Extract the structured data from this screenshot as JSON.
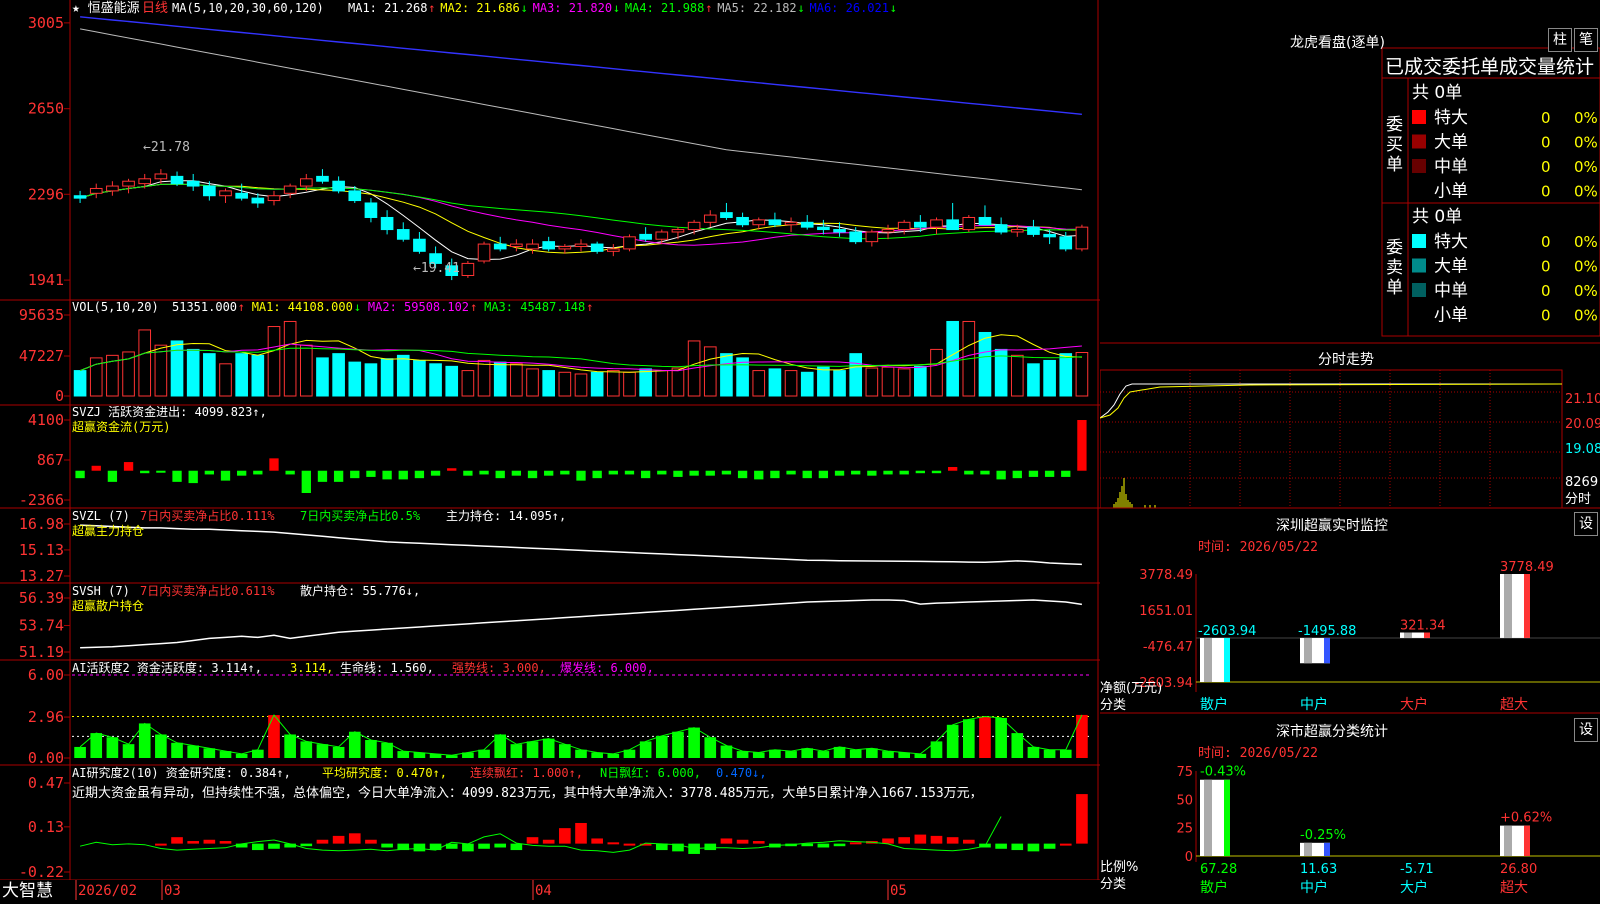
{
  "stock": {
    "name": "恒盛能源",
    "period": "日线",
    "star": "★",
    "ma_params": "MA(5,10,20,30,60,120)",
    "ma_values": [
      {
        "label": "MA1: 21.268",
        "arrow": "↑",
        "color": "#ffffff"
      },
      {
        "label": "MA2: 21.686",
        "arrow": "↓",
        "color": "#ffff00"
      },
      {
        "label": "MA3: 21.820",
        "arrow": "↓",
        "color": "#ff00ff"
      },
      {
        "label": "MA4: 21.988",
        "arrow": "↑",
        "color": "#00ff00"
      },
      {
        "label": "MA5: 22.182",
        "arrow": "↓",
        "color": "#bbbbbb"
      },
      {
        "label": "MA6: 26.021",
        "arrow": "↓",
        "color": "#0000ff"
      }
    ],
    "high_label": "←21.78",
    "low_label": "←19.41"
  },
  "panels": {
    "price": {
      "ticks": [
        "3005",
        "2650",
        "2296",
        "1941"
      ]
    },
    "vol": {
      "ticks": [
        "95635",
        "47227",
        "0"
      ],
      "title": "VOL(5,10,20)",
      "items": [
        {
          "text": "51351.000",
          "arrow": "↑",
          "color": "#ffffff"
        },
        {
          "text": "MA1: 44108.000",
          "arrow": "↓",
          "color": "#ffff00"
        },
        {
          "text": "MA2: 59508.102",
          "arrow": "↑",
          "color": "#ff00ff"
        },
        {
          "text": "MA3: 45487.148",
          "arrow": "↑",
          "color": "#00ff00"
        }
      ]
    },
    "svzj": {
      "ticks": [
        "4100",
        "867",
        "-2366"
      ],
      "title": "SVZJ  活跃资金进出: 4099.823↑,",
      "subtitle": "超赢资金流(万元)"
    },
    "svzl": {
      "ticks": [
        "16.98",
        "15.13",
        "13.27"
      ],
      "title_a": "SVZL (7)",
      "title_b": "7日内买卖净占比0.111%",
      "title_c": "7日内买卖净占比0.5%",
      "title_d": "主力持仓: 14.095↑,",
      "subtitle": "超赢主力持仓"
    },
    "svsh": {
      "ticks": [
        "56.39",
        "53.74",
        "51.19"
      ],
      "title_a": "SVSH (7)",
      "title_b": "7日内买卖净占比0.611%",
      "title_c": "散户持仓: 55.776↓,",
      "subtitle": "超赢散户持仓"
    },
    "ai1": {
      "ticks": [
        "6.00",
        "2.96",
        "0.00"
      ],
      "title_a": "AI活跃度2 资金活跃度: 3.114↑,",
      "title_b": "3.114,",
      "title_c": "生命线: 1.560,",
      "title_d": "强势线: 3.000,",
      "title_e": "爆发线: 6.000,"
    },
    "ai2": {
      "ticks": [
        "0.47",
        "0.13",
        "-0.22"
      ],
      "title_a": "AI研究度2(10) 资金研究度: 0.384↑,",
      "title_b": "平均研究度: 0.470↑,",
      "title_c": "连续飘红: 1.000↑,",
      "title_d": "N日飘红: 6.000,",
      "title_e": "0.470↓,",
      "comment": "近期大资金虽有异动，但持续性不强，总体偏空，今日大单净流入：4099.823万元，其中特大单净流入：3778.485万元，大单5日累计净入1667.153万元，"
    }
  },
  "footer": {
    "brand": "大智慧",
    "date_labels": [
      "2026/02",
      "03",
      "04",
      "05"
    ]
  },
  "longhu": {
    "title": "龙虎看盘(逐单)",
    "btn_zhu": "柱",
    "btn_bi": "笔",
    "header": "已成交委托单成交量统计",
    "buy_label": "委买单",
    "sell_label": "委卖单",
    "buy_total": "共 0单",
    "sell_total": "共 0单",
    "buy_rows": [
      {
        "name": "特大",
        "count": "0",
        "pct": "0%",
        "color": "#ff0000"
      },
      {
        "name": "大单",
        "count": "0",
        "pct": "0%",
        "color": "#990000"
      },
      {
        "name": "中单",
        "count": "0",
        "pct": "0%",
        "color": "#660000"
      },
      {
        "name": "小单",
        "count": "0",
        "pct": "0%",
        "color": "#000000"
      }
    ],
    "sell_rows": [
      {
        "name": "特大",
        "count": "0",
        "pct": "0%",
        "color": "#00ffff"
      },
      {
        "name": "大单",
        "count": "0",
        "pct": "0%",
        "color": "#008b8b"
      },
      {
        "name": "中单",
        "count": "0",
        "pct": "0%",
        "color": "#006060"
      },
      {
        "name": "小单",
        "count": "0",
        "pct": "0%",
        "color": "#000000"
      }
    ]
  },
  "fenshi": {
    "title": "分时走势",
    "ticks": [
      "21.10",
      "20.09",
      "19.08",
      "8269",
      "分时"
    ]
  },
  "shenzhen_monitor": {
    "title": "深圳超赢实时监控",
    "btn": "设",
    "time": "时间: 2026/05/22",
    "axis_ticks": [
      "3778.49",
      "1651.01",
      "-476.47",
      "-2603.94"
    ],
    "ylabel": "净额(万元)",
    "xlabel": "分类"
  },
  "shenshi_stats": {
    "title": "深市超赢分类统计",
    "btn": "设",
    "time": "时间: 2026/05/22",
    "axis_ticks": [
      "75",
      "50",
      "25",
      "0"
    ],
    "ylabel": "比例%",
    "xlabel": "分类"
  },
  "chart_data": [
    {
      "type": "candlestick",
      "title": "恒盛能源 日线",
      "ylim": [
        19.0,
        30.5
      ],
      "note": "approximate OHLC daily values read from chart",
      "candles": [
        [
          22.9,
          23.1,
          22.6,
          22.8
        ],
        [
          23.0,
          23.4,
          22.8,
          23.2
        ],
        [
          23.1,
          23.5,
          22.9,
          23.3
        ],
        [
          23.3,
          23.6,
          23.0,
          23.5
        ],
        [
          23.4,
          23.8,
          23.2,
          23.6
        ],
        [
          23.6,
          24.0,
          23.4,
          23.8
        ],
        [
          23.7,
          23.9,
          23.3,
          23.4
        ],
        [
          23.5,
          23.8,
          23.1,
          23.3
        ],
        [
          23.3,
          23.5,
          22.7,
          22.9
        ],
        [
          22.9,
          23.2,
          22.6,
          23.1
        ],
        [
          23.0,
          23.4,
          22.7,
          22.8
        ],
        [
          22.8,
          23.0,
          22.4,
          22.6
        ],
        [
          22.7,
          23.1,
          22.5,
          22.9
        ],
        [
          23.0,
          23.4,
          22.8,
          23.3
        ],
        [
          23.3,
          23.8,
          23.1,
          23.6
        ],
        [
          23.7,
          24.0,
          23.4,
          23.5
        ],
        [
          23.5,
          23.7,
          23.0,
          23.1
        ],
        [
          23.1,
          23.3,
          22.6,
          22.7
        ],
        [
          22.6,
          22.8,
          21.8,
          22.0
        ],
        [
          22.0,
          22.3,
          21.3,
          21.5
        ],
        [
          21.5,
          21.8,
          21.0,
          21.1
        ],
        [
          21.1,
          21.4,
          20.5,
          20.6
        ],
        [
          20.5,
          20.8,
          19.9,
          20.1
        ],
        [
          20.0,
          20.3,
          19.41,
          19.6
        ],
        [
          19.6,
          20.2,
          19.5,
          20.1
        ],
        [
          20.2,
          21.0,
          20.1,
          20.9
        ],
        [
          20.9,
          21.2,
          20.6,
          20.7
        ],
        [
          20.8,
          21.1,
          20.6,
          20.9
        ],
        [
          20.7,
          21.1,
          20.5,
          20.9
        ],
        [
          21.0,
          21.2,
          20.6,
          20.7
        ],
        [
          20.7,
          20.9,
          20.5,
          20.8
        ],
        [
          20.8,
          21.1,
          20.6,
          20.9
        ],
        [
          20.9,
          21.0,
          20.5,
          20.6
        ],
        [
          20.6,
          20.9,
          20.4,
          20.7
        ],
        [
          20.7,
          21.3,
          20.6,
          21.2
        ],
        [
          21.3,
          21.6,
          21.0,
          21.1
        ],
        [
          21.1,
          21.5,
          20.9,
          21.4
        ],
        [
          21.4,
          21.6,
          21.1,
          21.5
        ],
        [
          21.5,
          21.9,
          21.3,
          21.8
        ],
        [
          21.8,
          22.3,
          21.6,
          22.1
        ],
        [
          22.2,
          22.6,
          21.9,
          22.0
        ],
        [
          22.0,
          22.2,
          21.6,
          21.7
        ],
        [
          21.7,
          22.0,
          21.5,
          21.9
        ],
        [
          21.9,
          22.2,
          21.6,
          21.7
        ],
        [
          21.7,
          22.0,
          21.4,
          21.8
        ],
        [
          21.8,
          22.1,
          21.5,
          21.6
        ],
        [
          21.6,
          21.9,
          21.3,
          21.5
        ],
        [
          21.5,
          21.8,
          21.2,
          21.4
        ],
        [
          21.4,
          21.6,
          20.9,
          21.0
        ],
        [
          21.0,
          21.5,
          20.8,
          21.4
        ],
        [
          21.4,
          21.7,
          21.1,
          21.5
        ],
        [
          21.5,
          21.9,
          21.3,
          21.8
        ],
        [
          21.8,
          22.1,
          21.4,
          21.6
        ],
        [
          21.6,
          22.0,
          21.3,
          21.9
        ],
        [
          21.9,
          22.6,
          21.7,
          21.5
        ],
        [
          21.5,
          22.1,
          21.4,
          22.0
        ],
        [
          22.0,
          22.5,
          21.8,
          21.7
        ],
        [
          21.7,
          22.0,
          21.3,
          21.4
        ],
        [
          21.4,
          21.7,
          21.2,
          21.5
        ],
        [
          21.6,
          21.9,
          21.2,
          21.3
        ],
        [
          21.3,
          21.5,
          20.9,
          21.2
        ],
        [
          21.2,
          21.4,
          20.6,
          20.7
        ],
        [
          20.7,
          21.7,
          20.6,
          21.6
        ]
      ]
    },
    {
      "type": "bar",
      "title": "VOL(5,10,20)",
      "ylim": [
        0,
        95635
      ],
      "values": [
        30000,
        45000,
        48000,
        52000,
        78000,
        60000,
        65000,
        55000,
        50000,
        38000,
        50000,
        48000,
        82000,
        88000,
        60000,
        45000,
        50000,
        40000,
        38000,
        44000,
        48000,
        42000,
        38000,
        35000,
        30000,
        42000,
        40000,
        38000,
        32000,
        30000,
        28000,
        26000,
        28000,
        30000,
        28000,
        32000,
        30000,
        33000,
        65000,
        58000,
        50000,
        45000,
        30000,
        32000,
        30000,
        28000,
        34000,
        30000,
        50000,
        33000,
        34000,
        32000,
        35000,
        55000,
        88000,
        88000,
        75000,
        55000,
        48000,
        38000,
        42000,
        50000,
        51351
      ]
    },
    {
      "type": "bar",
      "title": "SVZJ 活跃资金进出",
      "ylim": [
        -2366,
        4100
      ],
      "values": [
        -600,
        400,
        -900,
        700,
        -200,
        -100,
        -900,
        -1000,
        -300,
        -800,
        -400,
        -300,
        1000,
        -300,
        -1800,
        -900,
        -900,
        -600,
        -500,
        -700,
        -700,
        -600,
        -400,
        200,
        -400,
        -300,
        -600,
        -400,
        -600,
        -400,
        -300,
        -800,
        -600,
        -300,
        -300,
        -600,
        -300,
        -500,
        -400,
        -400,
        -300,
        -600,
        -700,
        -600,
        -300,
        -600,
        -600,
        -400,
        -300,
        -400,
        -300,
        -300,
        -200,
        -200,
        300,
        -300,
        -300,
        -700,
        -600,
        -500,
        -500,
        -500,
        4099
      ]
    },
    {
      "type": "line",
      "title": "SVZL 主力持仓",
      "ylim": [
        13.27,
        16.98
      ],
      "values": [
        16.9,
        16.85,
        16.8,
        16.75,
        16.7,
        16.7,
        16.65,
        16.6,
        16.6,
        16.55,
        16.5,
        16.45,
        16.4,
        16.3,
        16.2,
        16.1,
        16.0,
        15.9,
        15.8,
        15.7,
        15.65,
        15.6,
        15.55,
        15.5,
        15.45,
        15.4,
        15.35,
        15.3,
        15.25,
        15.2,
        15.15,
        15.1,
        15.05,
        15.0,
        14.95,
        14.9,
        14.85,
        14.8,
        14.75,
        14.7,
        14.65,
        14.6,
        14.55,
        14.5,
        14.45,
        14.4,
        14.38,
        14.36,
        14.35,
        14.34,
        14.33,
        14.32,
        14.31,
        14.3,
        14.28,
        14.26,
        14.25,
        14.3,
        14.35,
        14.3,
        14.2,
        14.15,
        14.095
      ]
    },
    {
      "type": "line",
      "title": "SVSH 散户持仓",
      "ylim": [
        51.19,
        56.39
      ],
      "values": [
        51.6,
        51.65,
        51.7,
        51.8,
        51.9,
        52.0,
        52.1,
        52.3,
        52.5,
        52.6,
        52.7,
        52.6,
        52.8,
        52.5,
        52.7,
        52.9,
        53.1,
        53.2,
        53.3,
        53.4,
        53.5,
        53.6,
        53.7,
        53.8,
        53.9,
        54.0,
        54.1,
        54.2,
        54.3,
        54.4,
        54.5,
        54.6,
        54.7,
        54.8,
        54.9,
        55.0,
        55.1,
        55.2,
        55.3,
        55.4,
        55.5,
        55.6,
        55.7,
        55.8,
        55.9,
        56.0,
        56.05,
        56.1,
        56.15,
        56.2,
        56.2,
        56.15,
        55.8,
        55.9,
        55.95,
        56.0,
        56.05,
        56.1,
        56.15,
        56.2,
        56.1,
        56.0,
        55.776
      ]
    },
    {
      "type": "bar",
      "title": "AI活跃度2",
      "ylim": [
        0,
        6.0
      ],
      "values": [
        0.8,
        1.8,
        1.5,
        1.0,
        2.5,
        1.7,
        1.1,
        0.9,
        0.7,
        0.5,
        0.3,
        0.6,
        3.1,
        1.7,
        1.2,
        1.0,
        0.8,
        1.9,
        1.3,
        1.1,
        0.5,
        0.4,
        0.3,
        0.2,
        0.4,
        0.6,
        1.7,
        1.0,
        1.2,
        1.4,
        1.0,
        0.6,
        0.4,
        0.3,
        0.6,
        1.2,
        1.6,
        1.9,
        2.2,
        1.5,
        0.9,
        0.5,
        0.4,
        0.6,
        0.5,
        0.7,
        0.5,
        0.8,
        0.6,
        0.7,
        0.5,
        0.4,
        0.3,
        1.2,
        2.4,
        2.8,
        3.0,
        2.9,
        1.8,
        0.8,
        0.6,
        0.6,
        3.114
      ]
    },
    {
      "type": "bar",
      "title": "AI研究度2(10)",
      "ylim": [
        -0.22,
        0.47
      ],
      "values": [
        0.0,
        0.05,
        0.02,
        0.03,
        0.02,
        -0.03,
        -0.05,
        -0.04,
        -0.03,
        -0.02,
        0.03,
        0.06,
        0.08,
        0.03,
        -0.03,
        -0.05,
        -0.06,
        -0.05,
        -0.04,
        -0.06,
        -0.04,
        -0.03,
        -0.05,
        0.05,
        0.03,
        0.12,
        0.16,
        0.04,
        0.01,
        0.0,
        0.0,
        -0.05,
        -0.06,
        -0.08,
        -0.05,
        0.04,
        0.03,
        0.02,
        -0.03,
        -0.02,
        -0.02,
        -0.03,
        -0.02,
        0.01,
        0.02,
        0.04,
        0.05,
        0.07,
        0.06,
        0.05,
        0.03,
        -0.03,
        -0.04,
        -0.05,
        -0.06,
        -0.04,
        0.0,
        0.384
      ]
    },
    {
      "type": "bar",
      "title": "深圳超赢实时监控",
      "ylim": [
        -2603.94,
        3778.49
      ],
      "categories": [
        "散户",
        "中户",
        "大户",
        "超大"
      ],
      "values": [
        -2603.94,
        -1495.88,
        321.34,
        3778.49
      ]
    },
    {
      "type": "bar",
      "title": "深市超赢分类统计",
      "ylim": [
        0,
        75
      ],
      "categories": [
        "散户",
        "中户",
        "大户",
        "超大"
      ],
      "values": [
        67.28,
        11.63,
        -5.71,
        26.8
      ],
      "changes": [
        "-0.43%",
        "-0.25%",
        "",
        "+0.62%"
      ]
    }
  ]
}
